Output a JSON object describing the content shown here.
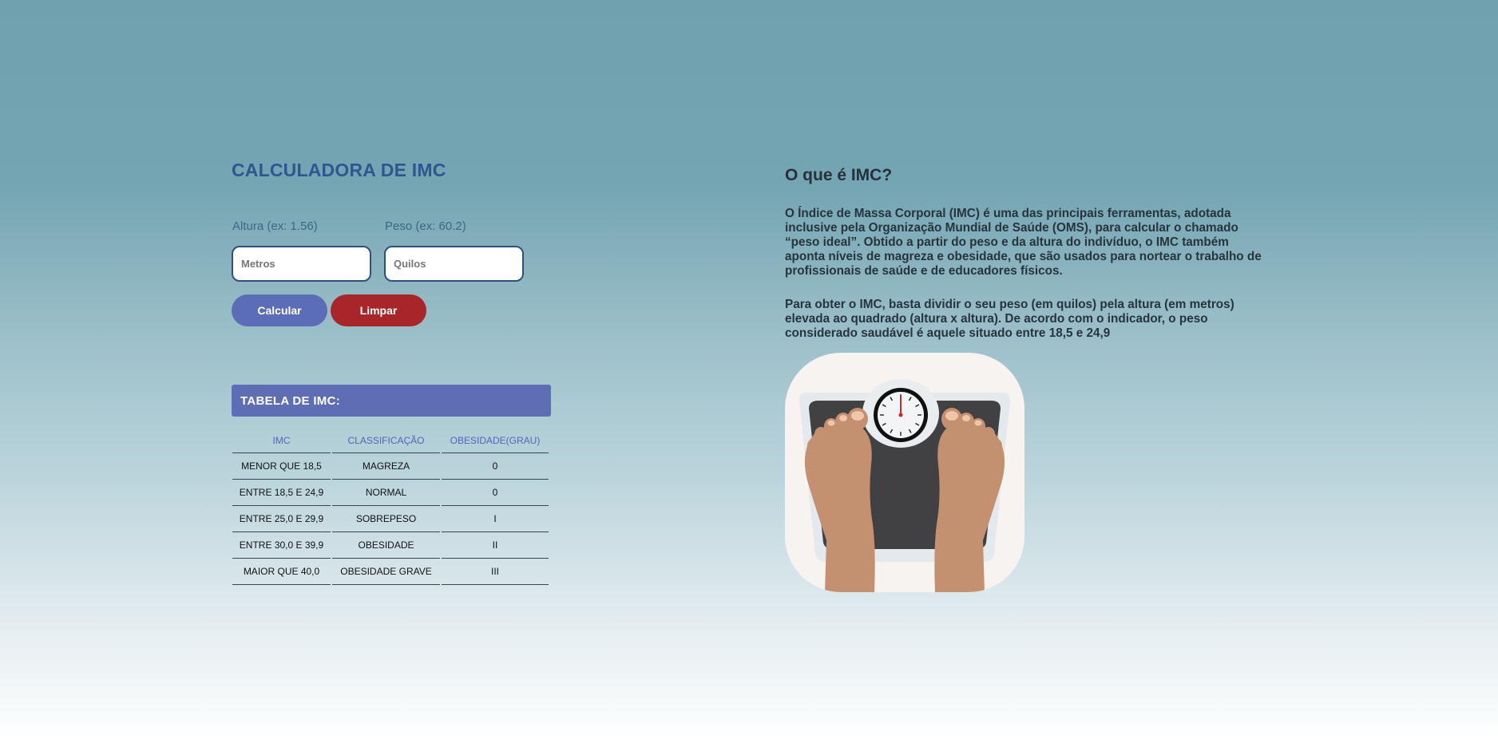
{
  "calculator": {
    "title": "CALCULADORA DE IMC",
    "height_label": "Altura (ex: 1.56)",
    "height_placeholder": "Metros",
    "weight_label": "Peso (ex: 60.2)",
    "weight_placeholder": "Quilos",
    "calculate_label": "Calcular",
    "clear_label": "Limpar",
    "colors": {
      "title": "#2f5691",
      "calculate_button": "#5b6db6",
      "clear_button": "#a82629",
      "table_header": "#5e6eb5"
    }
  },
  "table": {
    "title": "TABELA DE IMC:",
    "columns": [
      "IMC",
      "CLASSIFICAÇÃO",
      "OBESIDADE(GRAU)"
    ],
    "rows": [
      [
        "MENOR QUE 18,5",
        "MAGREZA",
        "0"
      ],
      [
        "ENTRE 18,5 E 24,9",
        "NORMAL",
        "0"
      ],
      [
        "ENTRE 25,0 E 29,9",
        "SOBREPESO",
        "I"
      ],
      [
        "ENTRE 30,0 E 39,9",
        "OBESIDADE",
        "II"
      ],
      [
        "MAIOR QUE 40,0",
        "OBESIDADE GRAVE",
        "III"
      ]
    ]
  },
  "info": {
    "title": "O que é IMC?",
    "paragraph1": "O Índice de Massa Corporal (IMC) é uma das principais ferramentas, adotada inclusive pela Organização Mundial de Saúde (OMS), para calcular o chamado “peso ideal”. Obtido a partir do peso e da altura do indivíduo, o IMC também aponta níveis de magreza e obesidade, que são usados para nortear o trabalho de profissionais de saúde e de educadores físicos.",
    "paragraph2": "Para obter o IMC, basta dividir o seu peso (em quilos) pela altura (em metros) elevada ao quadrado (altura x altura). De acordo com o indicador, o peso considerado saudável é aquele situado entre 18,5 e 24,9",
    "illustration_icon": "bathroom-scale-feet-icon"
  }
}
